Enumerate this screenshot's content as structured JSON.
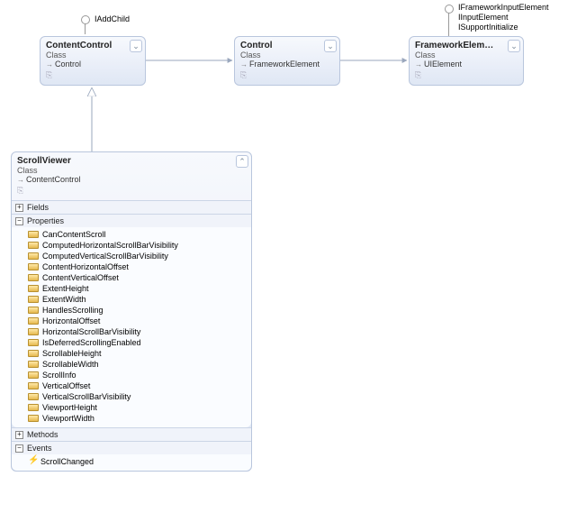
{
  "interfaces": {
    "iaddchild": "IAddChild",
    "fw_input": "IFrameworkInputElement",
    "input": "IInputElement",
    "support_init": "ISupportInitialize"
  },
  "classes": {
    "content_control": {
      "name": "ContentControl",
      "stereo": "Class",
      "base": "Control"
    },
    "control": {
      "name": "Control",
      "stereo": "Class",
      "base": "FrameworkElement"
    },
    "framework_element": {
      "name": "FrameworkElem…",
      "stereo": "Class",
      "base": "UIElement"
    },
    "scroll_viewer": {
      "name": "ScrollViewer",
      "stereo": "Class",
      "base": "ContentControl"
    }
  },
  "sections": {
    "fields": "Fields",
    "properties": "Properties",
    "methods": "Methods",
    "events": "Events"
  },
  "properties": [
    "CanContentScroll",
    "ComputedHorizontalScrollBarVisibility",
    "ComputedVerticalScrollBarVisibility",
    "ContentHorizontalOffset",
    "ContentVerticalOffset",
    "ExtentHeight",
    "ExtentWidth",
    "HandlesScrolling",
    "HorizontalOffset",
    "HorizontalScrollBarVisibility",
    "IsDeferredScrollingEnabled",
    "ScrollableHeight",
    "ScrollableWidth",
    "ScrollInfo",
    "VerticalOffset",
    "VerticalScrollBarVisibility",
    "ViewportHeight",
    "ViewportWidth"
  ],
  "events": [
    "ScrollChanged"
  ],
  "toggles": {
    "plus": "+",
    "minus": "−"
  },
  "chevrons": {
    "expand": "⌄",
    "collapse": "⌃"
  }
}
